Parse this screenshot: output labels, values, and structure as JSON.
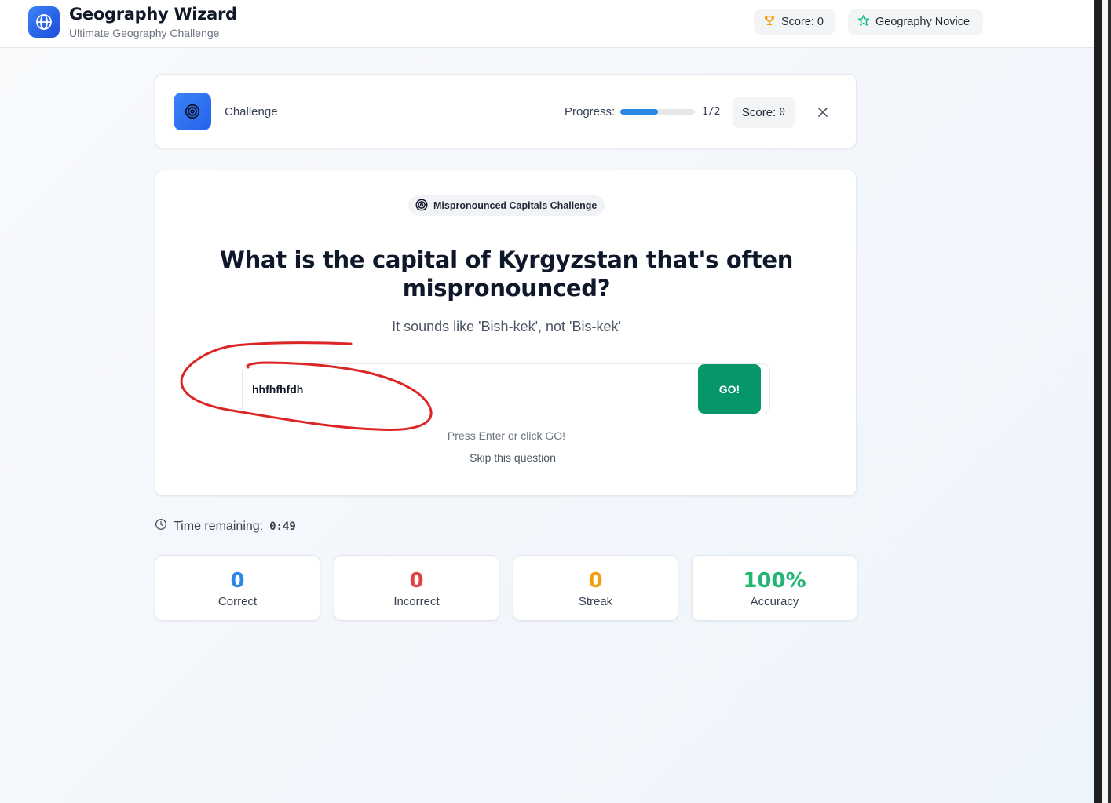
{
  "header": {
    "title": "Geography Wizard",
    "subtitle": "Ultimate Geography Challenge",
    "score_label": "Score: 0",
    "rank_label": "Geography Novice"
  },
  "challenge_bar": {
    "label": "Challenge",
    "progress_label": "Progress:",
    "progress_fraction": 0.5,
    "progress_count": "1/2",
    "score_label": "Score:",
    "score_value": "0"
  },
  "question_card": {
    "badge": "Mispronounced Capitals Challenge",
    "question": "What is the capital of Kyrgyzstan that's often mispronounced?",
    "hint": "It sounds like 'Bish-kek', not 'Bis-kek'",
    "answer_value": "hhfhfhfdh",
    "go_label": "GO!",
    "press_hint": "Press Enter or click GO!",
    "skip_label": "Skip this question"
  },
  "timer": {
    "label": "Time remaining:",
    "value": "0:49"
  },
  "stats": [
    {
      "value": "0",
      "label": "Correct",
      "color": "#2b87e6"
    },
    {
      "value": "0",
      "label": "Incorrect",
      "color": "#e04545"
    },
    {
      "value": "0",
      "label": "Streak",
      "color": "#f59e0b"
    },
    {
      "value": "100%",
      "label": "Accuracy",
      "color": "#22b573"
    }
  ],
  "colors": {
    "accent": "#2b87e6",
    "go_button": "#059669",
    "annotation": "#dc2626"
  },
  "icons": {
    "logo": "globe-icon",
    "score": "trophy-icon",
    "rank": "star-icon",
    "challenge": "target-icon",
    "close": "close-icon",
    "timer": "clock-icon"
  }
}
